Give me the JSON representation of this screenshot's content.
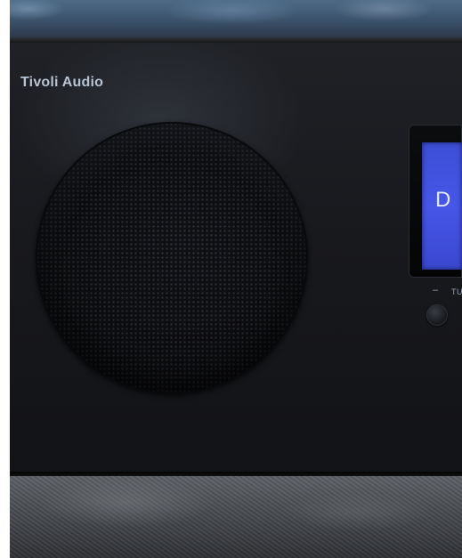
{
  "photo": {
    "brand_label": "Tivoli Audio",
    "display_text": "D",
    "minus_label": "–",
    "tune_label": "TU",
    "display_color": "#4656e8",
    "brand_color": "#b7c3d2",
    "body_color": "#18191d"
  }
}
